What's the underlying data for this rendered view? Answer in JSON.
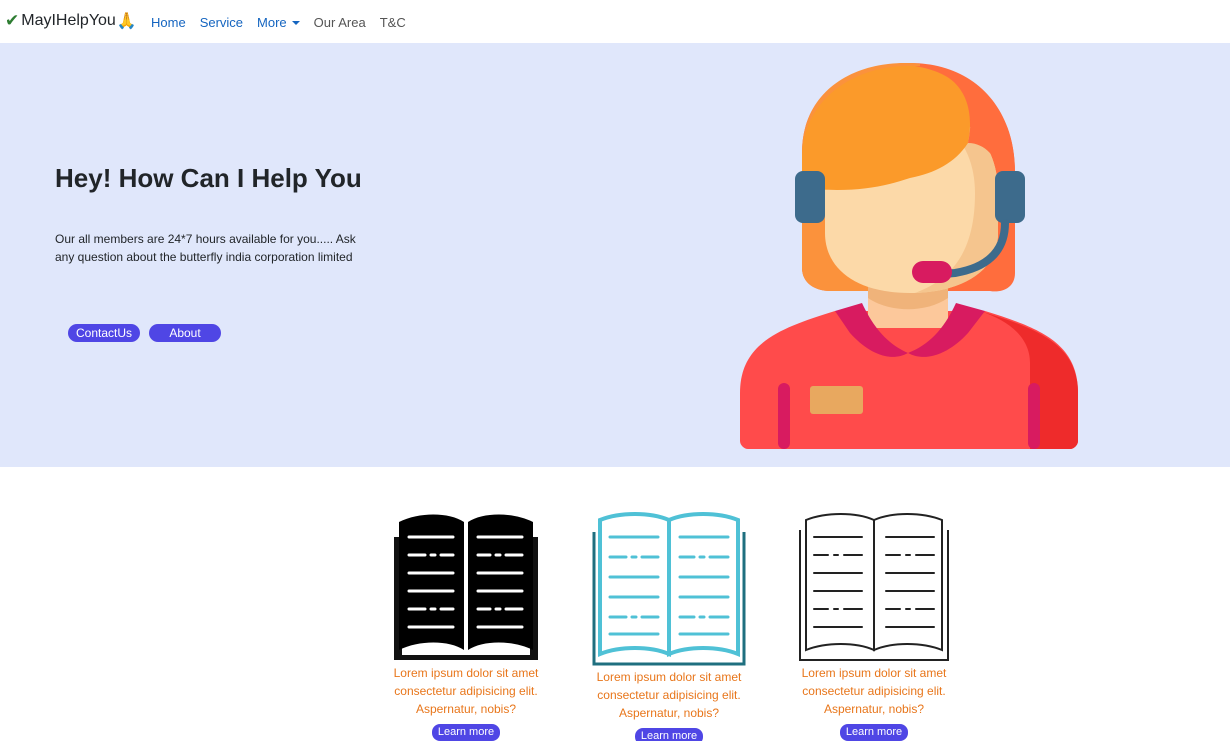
{
  "brand": {
    "name": "MayIHelpYou"
  },
  "nav": {
    "home": "Home",
    "service": "Service",
    "more": "More",
    "our_area": "Our Area",
    "tc": "T&C"
  },
  "hero": {
    "title": "Hey! How Can I Help You",
    "description": "Our all members are 24*7 hours available for you..... Ask any question about the butterfly india corporation limited",
    "contact_label": "ContactUs",
    "about_label": "About"
  },
  "cards": [
    {
      "text": "Lorem ipsum dolor sit amet consectetur adipisicing elit. Aspernatur, nobis?",
      "button": "Learn more",
      "icon": "book-icon-black"
    },
    {
      "text": "Lorem ipsum dolor sit amet consectetur adipisicing elit. Aspernatur, nobis?",
      "button": "Learn more",
      "icon": "book-icon-blue"
    },
    {
      "text": "Lorem ipsum dolor sit amet consectetur adipisicing elit. Aspernatur, nobis?",
      "button": "Learn more",
      "icon": "book-icon-outline"
    }
  ],
  "colors": {
    "hero_bg": "#e0e7fb",
    "button": "#4f46e5",
    "card_text": "#e8761b",
    "nav_link": "#1565c0"
  }
}
